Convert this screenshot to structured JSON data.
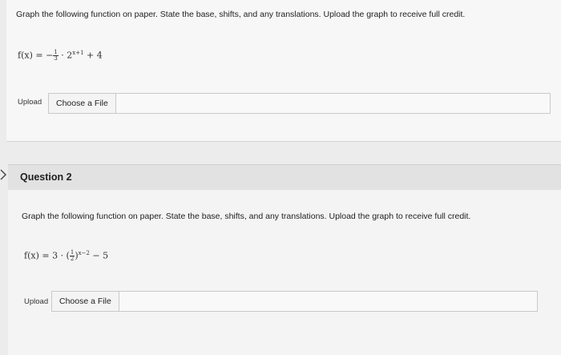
{
  "question1": {
    "prompt": "Graph the following function on paper. State the base, shifts, and any translations. Upload the graph to receive full credit.",
    "formula": {
      "lhs": "f(x) = −",
      "frac_num": "1",
      "frac_den": "3",
      "mid": " · 2",
      "exponent": "x+1",
      "tail": " + 4"
    },
    "upload_label": "Upload",
    "file_button_label": "Choose a File"
  },
  "question2": {
    "title": "Question 2",
    "prompt": "Graph the following function on paper. State the base, shifts, and any translations. Upload the graph to receive full credit.",
    "formula": {
      "lhs": "f(x) = 3 · (",
      "frac_num": "1",
      "frac_den": "2",
      "close": ")",
      "exponent": "x−2",
      "tail": " − 5"
    },
    "upload_label": "Upload",
    "file_button_label": "Choose a File"
  },
  "icons": {
    "question_indicator": "chevron-right-icon"
  }
}
